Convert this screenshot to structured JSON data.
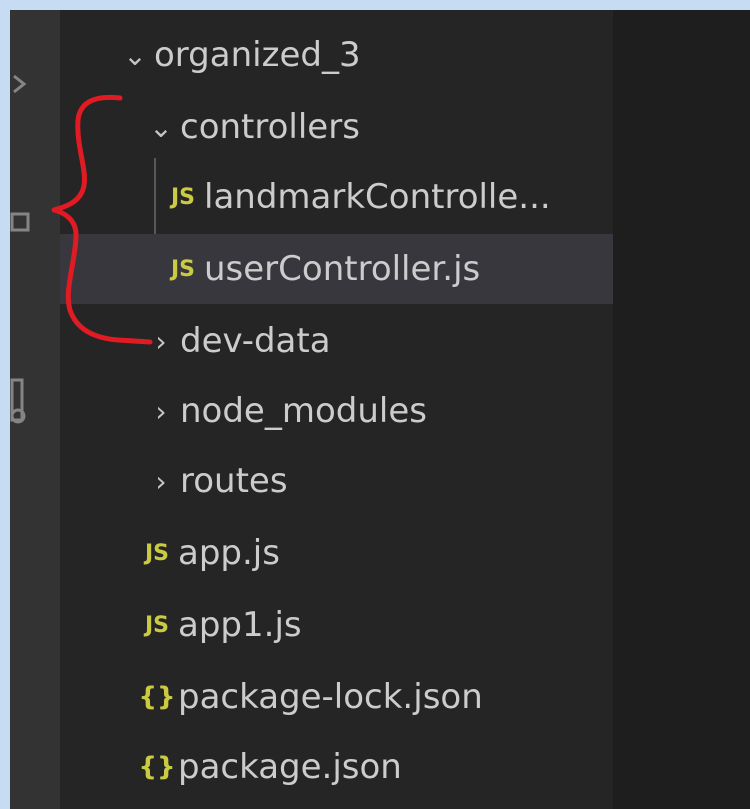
{
  "explorer": {
    "root": {
      "label": "organized_3",
      "expanded": true,
      "twisty": "chevron-down"
    },
    "items": [
      {
        "label": "controllers",
        "type": "folder",
        "expanded": true,
        "twisty": "chevron-down"
      },
      {
        "label": "landmarkControlle...",
        "type": "js-file",
        "badge": "JS"
      },
      {
        "label": "userController.js",
        "type": "js-file",
        "badge": "JS",
        "selected": true
      },
      {
        "label": "dev-data",
        "type": "folder",
        "expanded": false,
        "twisty": "chevron-right"
      },
      {
        "label": "node_modules",
        "type": "folder",
        "expanded": false,
        "twisty": "chevron-right"
      },
      {
        "label": "routes",
        "type": "folder",
        "expanded": false,
        "twisty": "chevron-right"
      },
      {
        "label": "app.js",
        "type": "js-file",
        "badge": "JS"
      },
      {
        "label": "app1.js",
        "type": "js-file",
        "badge": "JS"
      },
      {
        "label": "package-lock.json",
        "type": "json-file",
        "badge": "{}"
      },
      {
        "label": "package.json",
        "type": "json-file",
        "badge": "{}"
      }
    ]
  },
  "colors": {
    "explorer_bg": "#252526",
    "activity_bar_bg": "#333333",
    "editor_bg": "#1e1e1e",
    "selected_row_bg": "#37373d",
    "text": "#cccccc",
    "js_badge": "#cbcb41",
    "json_badge": "#cbcb41",
    "annotation_red": "#e01b24",
    "window_border": "#c7dbf2"
  },
  "annotation": {
    "shape": "curly-brace",
    "color": "#e01b24"
  }
}
